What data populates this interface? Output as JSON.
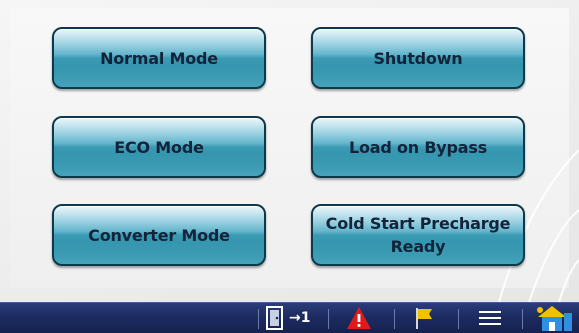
{
  "buttons": {
    "normal_mode": "Normal Mode",
    "shutdown": "Shutdown",
    "eco_mode": "ECO Mode",
    "load_on_bypass": "Load on Bypass",
    "converter_mode": "Converter Mode",
    "cold_start_line1": "Cold Start Precharge",
    "cold_start_line2": "Ready"
  },
  "taskbar": {
    "login_indicator": "→1",
    "icons": [
      "door-login-icon",
      "alarm-warning-icon",
      "event-flag-icon",
      "menu-icon",
      "home-icon"
    ]
  },
  "colors": {
    "button_base": "#3d9bb4",
    "button_border": "#0d3a4a",
    "taskbar": "#1c2a5e",
    "alarm": "#e01a1a",
    "flag": "#f2c200"
  }
}
